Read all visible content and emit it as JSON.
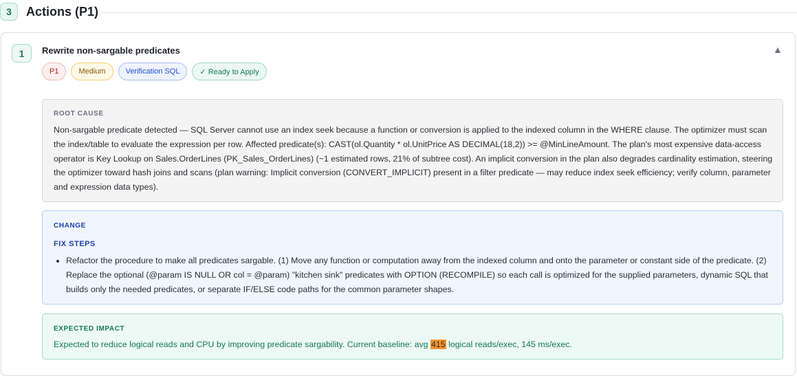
{
  "section": {
    "number": "3",
    "title": "Actions (P1)"
  },
  "item": {
    "number": "1",
    "title": "Rewrite non-sargable predicates",
    "collapse_icon": "▲",
    "badges": {
      "priority": "P1",
      "severity": "Medium",
      "verification": "Verification SQL",
      "status": "✓ Ready to Apply"
    }
  },
  "root_cause": {
    "label": "ROOT CAUSE",
    "text": "Non-sargable predicate detected — SQL Server cannot use an index seek because a function or conversion is applied to the indexed column in the WHERE clause. The optimizer must scan the index/table to evaluate the expression per row. Affected predicate(s): CAST(ol.Quantity * ol.UnitPrice AS DECIMAL(18,2)) >= @MinLineAmount. The plan's most expensive data-access operator is Key Lookup on Sales.OrderLines (PK_Sales_OrderLines) (~1 estimated rows, 21% of subtree cost). An implicit conversion in the plan also degrades cardinality estimation, steering the optimizer toward hash joins and scans (plan warning: Implicit conversion (CONVERT_IMPLICIT) present in a filter predicate — may reduce index seek efficiency; verify column, parameter and expression data types)."
  },
  "change": {
    "label": "CHANGE",
    "fix_label": "FIX STEPS",
    "steps": [
      "Refactor the procedure to make all predicates sargable. (1) Move any function or computation away from the indexed column and onto the parameter or constant side of the predicate. (2) Replace the optional (@param IS NULL OR col = @param) \"kitchen sink\" predicates with OPTION (RECOMPILE) so each call is optimized for the supplied parameters, dynamic SQL that builds only the needed predicates, or separate IF/ELSE code paths for the common parameter shapes."
    ]
  },
  "impact": {
    "label": "EXPECTED IMPACT",
    "text_before": "Expected to reduce logical reads and CPU by improving predicate sargability. Current baseline: avg ",
    "highlight": "415",
    "text_after": " logical reads/exec, 145 ms/exec."
  }
}
